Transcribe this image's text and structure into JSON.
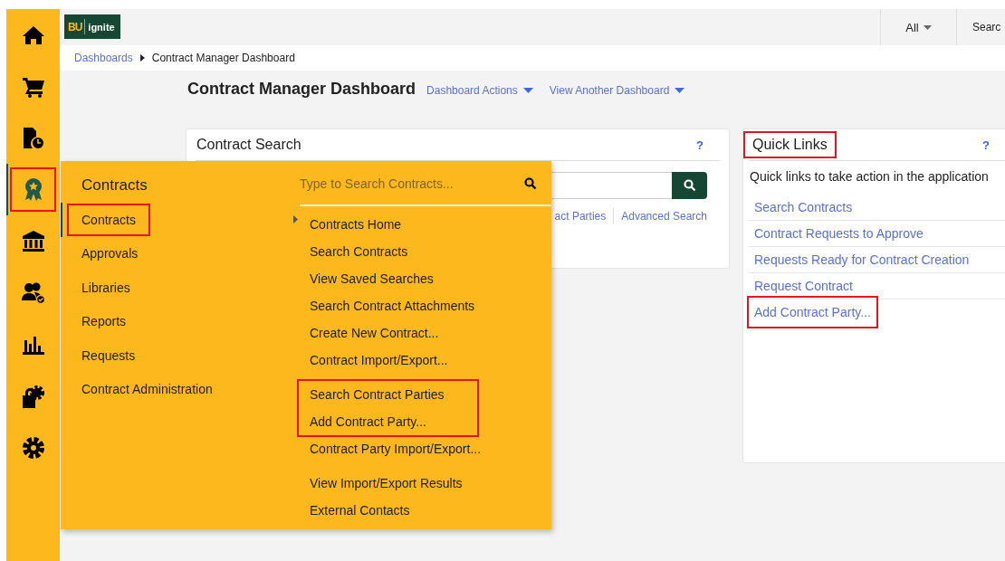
{
  "rail": [
    {
      "selected": false,
      "highlighted": false
    },
    {
      "selected": false,
      "highlighted": false
    },
    {
      "selected": false,
      "highlighted": false
    },
    {
      "selected": true,
      "highlighted": true
    },
    {
      "selected": false,
      "highlighted": false
    },
    {
      "selected": false,
      "highlighted": false
    },
    {
      "selected": false,
      "highlighted": false
    },
    {
      "selected": false,
      "highlighted": false
    },
    {
      "selected": false,
      "highlighted": false
    }
  ],
  "logo": {
    "mark": "BU",
    "name": "ignite"
  },
  "topbar": {
    "scope": "All",
    "search": "Searc"
  },
  "breadcrumb": [
    {
      "label": "Dashboards",
      "link": true
    },
    {
      "label": "Contract Manager Dashboard",
      "link": false
    }
  ],
  "page": {
    "title": "Contract Manager Dashboard",
    "actions": [
      "Dashboard Actions",
      "View Another Dashboard"
    ]
  },
  "contract_search": {
    "title": "Contract Search",
    "help": "?",
    "links": [
      "act Parties",
      "Advanced Search"
    ]
  },
  "quick_links": {
    "title": "Quick Links",
    "highlighted": true,
    "help": "?",
    "description": "Quick links to take action in the application",
    "links": [
      {
        "label": "Search Contracts",
        "highlighted": false
      },
      {
        "label": "Contract Requests to Approve",
        "highlighted": false
      },
      {
        "label": "Requests Ready for Contract Creation",
        "highlighted": false
      },
      {
        "label": "Request Contract",
        "highlighted": false
      },
      {
        "label": "Add Contract Party...",
        "highlighted": true
      }
    ]
  },
  "menu": {
    "title": "Contracts",
    "categories": [
      {
        "label": "Contracts",
        "selected": true,
        "highlighted": true
      },
      {
        "label": "Approvals",
        "selected": false,
        "highlighted": false
      },
      {
        "label": "Libraries",
        "selected": false,
        "highlighted": false
      },
      {
        "label": "Reports",
        "selected": false,
        "highlighted": false
      },
      {
        "label": "Requests",
        "selected": false,
        "highlighted": false
      },
      {
        "label": "Contract Administration",
        "selected": false,
        "highlighted": false
      }
    ],
    "search": {
      "placeholder": "Type to Search Contracts..."
    },
    "groups": [
      {
        "highlighted": false,
        "items": [
          "Contracts Home",
          "Search Contracts",
          "View Saved Searches",
          "Search Contract Attachments",
          "Create New Contract...",
          "Contract Import/Export..."
        ]
      },
      {
        "highlighted": true,
        "items": [
          "Search Contract Parties",
          "Add Contract Party..."
        ]
      },
      {
        "highlighted": false,
        "items": [
          "Contract Party Import/Export..."
        ]
      },
      {
        "highlighted": false,
        "items": [
          "View Import/Export Results",
          "External Contacts"
        ]
      }
    ]
  }
}
